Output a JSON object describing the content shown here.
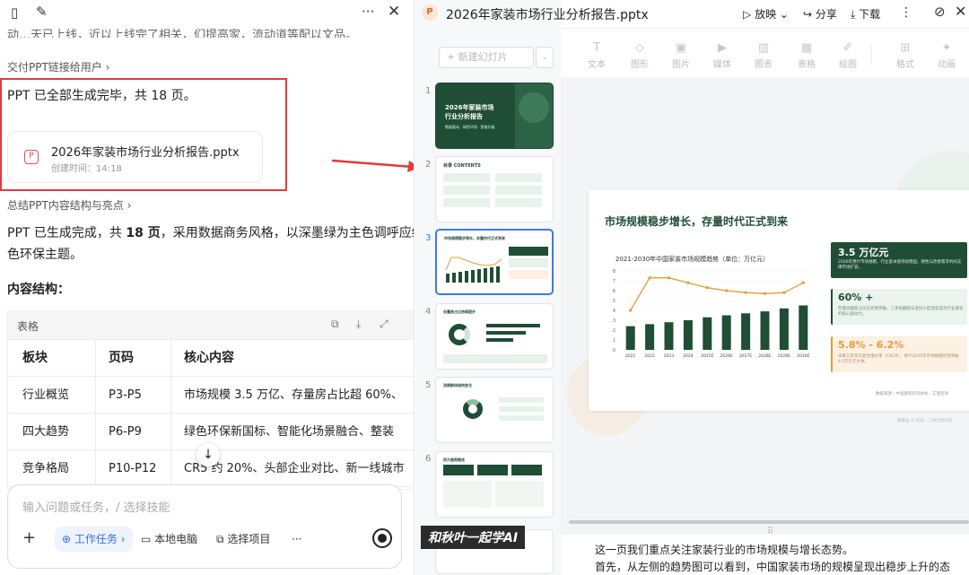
{
  "left": {
    "top_cut_text": "动…天已上线，近以上线完了相关，们提高家，流动道等配以文品。",
    "deliver_link": "交付PPT链接给用户 ›",
    "done_text": "PPT 已全部生成完毕，共 18 页。",
    "file": {
      "name": "2026年家装市场行业分析报告.pptx",
      "time": "创建时间：14:18"
    },
    "summary_link": "总结PPT内容结构与亮点 ›",
    "para_a": "PPT 已生成完成，共 ",
    "para_b": "18 页",
    "para_c": "，采用数据商务风格，以深墨绿为主色调呼应绿",
    "para_d": "色环保主题。",
    "section_title": "内容结构：",
    "table": {
      "title": "表格",
      "headers": [
        "板块",
        "页码",
        "核心内容"
      ],
      "rows": [
        [
          "行业概览",
          "P3-P5",
          "市场规模 3.5 万亿、存量房占比超 60%、"
        ],
        [
          "四大趋势",
          "P6-P9",
          "绿色环保新国标、智能化场景融合、整装"
        ],
        [
          "竞争格局",
          "P10-P12",
          "CR5 约 20%、头部企业对比、新一线城市"
        ]
      ]
    },
    "input": {
      "placeholder": "输入问题或任务，/ 选择技能",
      "chip_task": "工作任务",
      "chip_local": "本地电脑",
      "chip_project": "选择项目",
      "chip_more": "···"
    }
  },
  "mid": {
    "new_slide": "新建幻灯片",
    "slides": [
      {
        "num": "1",
        "title": "2026年家装市场行业分析报告",
        "sub": "数据驱动 · 绿色环保 · 智能升级"
      },
      {
        "num": "2",
        "title": "目录 CONTENTS"
      },
      {
        "num": "3",
        "title": "市场规模稳步增长，存量时代正式到来"
      },
      {
        "num": "4",
        "title": "存量房占比持续提升"
      },
      {
        "num": "5",
        "title": "消费群体结构变化"
      },
      {
        "num": "6",
        "title": "四大趋势概览"
      }
    ]
  },
  "right": {
    "file_title": "2026年家装市场行业分析报告.pptx",
    "btn_play": "放映",
    "btn_share": "分享",
    "btn_download": "下载",
    "toolbar": [
      "文本",
      "图形",
      "图片",
      "媒体",
      "图表",
      "表格",
      "绘图",
      "格式",
      "动画"
    ],
    "slide": {
      "title": "市场规模稳步增长，存量时代正式到来",
      "chart_title": "2021-2030年中国家装市场规模趋势（单位：万亿元）",
      "card1_value": "3.5 万亿元",
      "card1_text": "2026年预计市场规模，行业基本盘持续稳固，刚性与改善需求共同支撑市场扩容。",
      "card2_value": "60% +",
      "card2_text": "存量房翻新占比历史性突破，二手房翻新与老旧小区改造成为行业增长的核心驱动力。",
      "card3_value": "5.8% - 6.2%",
      "card3_text": "未来三年年均复合增长率（CAGR），预计2030年市场规模有望突破4.5万亿元大关。",
      "source": "数据来源：中国建筑装饰协会、艾瑞咨询",
      "footer": "数据由 AI 生成，飞书文档同步"
    },
    "notes_line1": "这一页我们重点关注家装行业的市场规模与增长态势。",
    "notes_line2": "首先，从左侧的趋势图可以看到，中国家装市场的规模呈现出稳步上升的态",
    "watermark": "和秋叶一起学AI"
  },
  "colors": {
    "accent_green": "#1f4d35",
    "orange": "#e69a3a",
    "red_box": "#e23b3b",
    "blue_select": "#3b7be8"
  },
  "chart_data": {
    "type": "bar",
    "title": "2021-2030年中国家装市场规模趋势（单位：万亿元）",
    "categories": [
      "2021",
      "2022",
      "2023",
      "2024",
      "2025E",
      "2026E",
      "2027E",
      "2028E",
      "2029E",
      "2030E"
    ],
    "ylim": [
      0,
      8
    ],
    "yticks": [
      0,
      1,
      2,
      3,
      4,
      5,
      6,
      7,
      8
    ],
    "series": [
      {
        "type": "bar",
        "values": [
          2.4,
          2.6,
          2.8,
          3.0,
          3.3,
          3.5,
          3.7,
          3.9,
          4.2,
          4.5
        ]
      },
      {
        "type": "line",
        "values": [
          4.0,
          7.3,
          7.3,
          6.8,
          6.3,
          6.0,
          5.8,
          5.7,
          5.8,
          6.8
        ]
      }
    ]
  }
}
